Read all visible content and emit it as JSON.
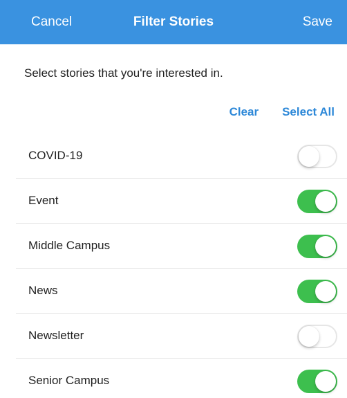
{
  "header": {
    "left_label": "Cancel",
    "title": "Filter Stories",
    "right_label": "Save"
  },
  "instructions": "Select stories that you're interested in.",
  "actions": {
    "clear_label": "Clear",
    "select_all_label": "Select All"
  },
  "stories": [
    {
      "label": "COVID-19",
      "enabled": false
    },
    {
      "label": "Event",
      "enabled": true
    },
    {
      "label": "Middle Campus",
      "enabled": true
    },
    {
      "label": "News",
      "enabled": true
    },
    {
      "label": "Newsletter",
      "enabled": false
    },
    {
      "label": "Senior Campus",
      "enabled": true
    }
  ],
  "colors": {
    "header_background": "#3a92e0",
    "accent_link": "#2d88d8",
    "toggle_on": "#3dbf4e",
    "toggle_off_border": "#e6e6e6"
  }
}
